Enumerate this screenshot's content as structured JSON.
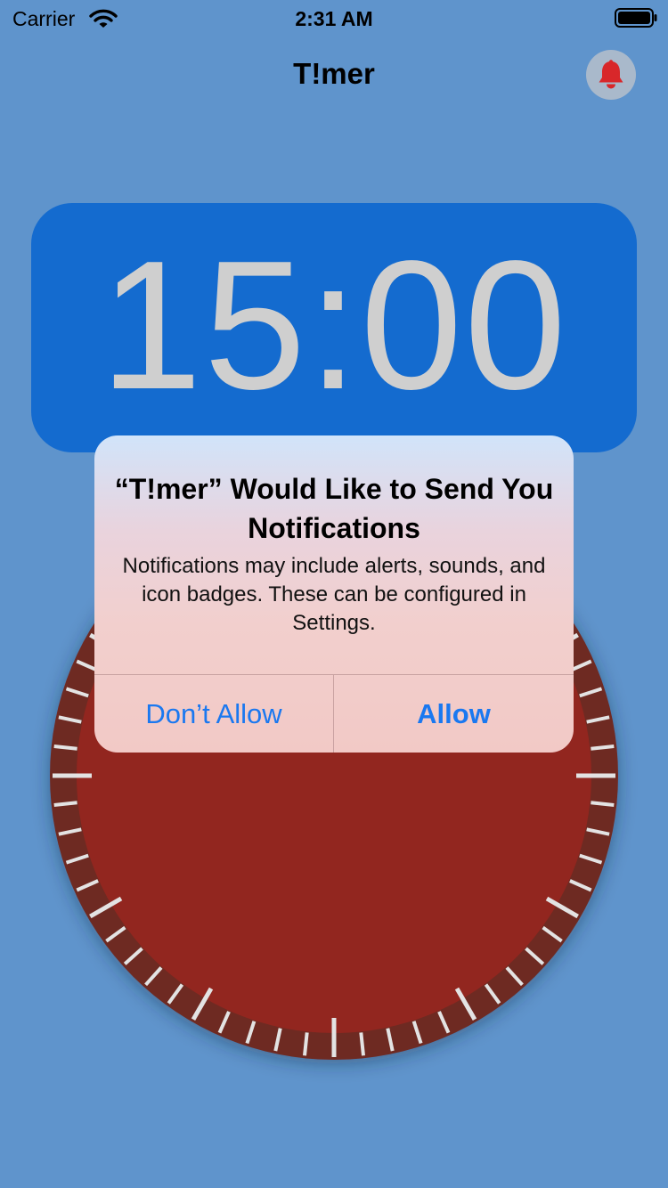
{
  "status_bar": {
    "carrier": "Carrier",
    "time": "2:31 AM"
  },
  "nav": {
    "title": "T!mer",
    "bell_icon": "bell-icon",
    "bell_color": "#d8272a"
  },
  "timer": {
    "display": "15:00"
  },
  "dial": {
    "fill": "#92261f",
    "rim": "#6e2a23",
    "tick_color": "#e3e3e3",
    "tick_count": 60
  },
  "alert": {
    "title": "“T!mer” Would Like to Send You Notifications",
    "message": "Notifications may include alerts, sounds, and icon badges. These can be configured in Settings.",
    "deny_label": "Don’t Allow",
    "allow_label": "Allow",
    "button_color": "#1a78f0"
  }
}
